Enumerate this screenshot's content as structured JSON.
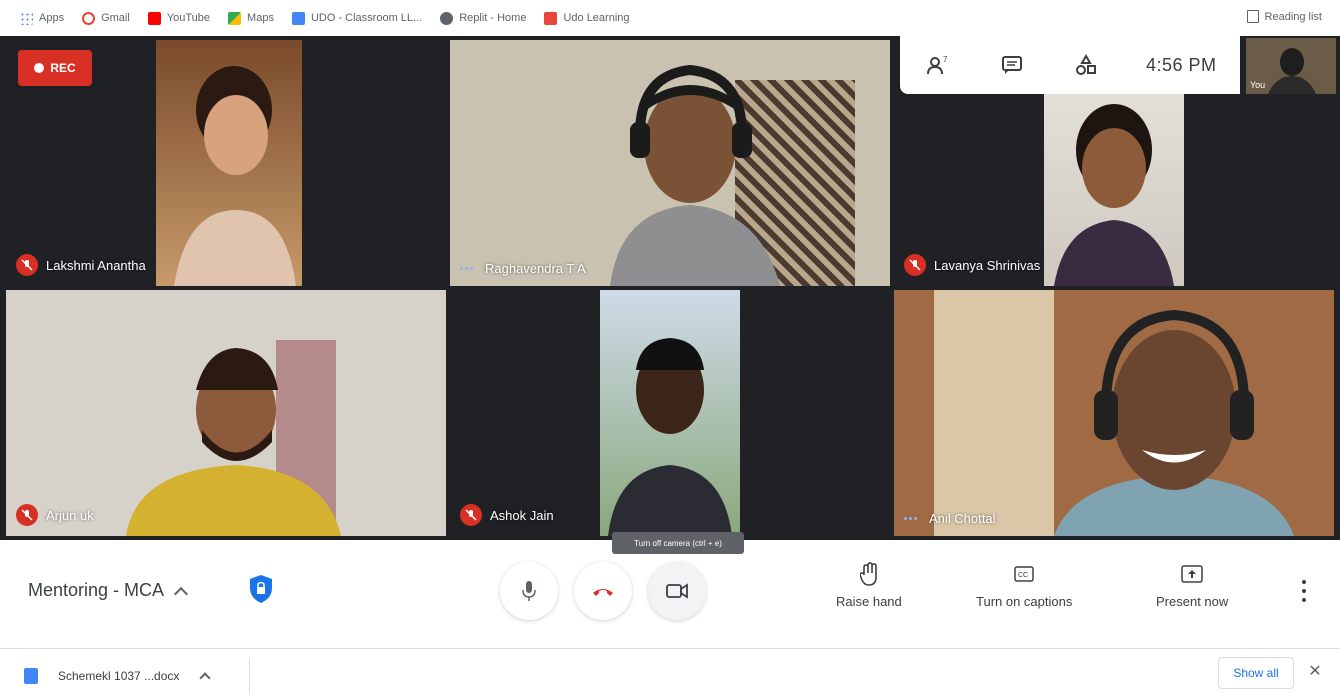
{
  "bookmarks": [
    {
      "label": "Apps",
      "color": "#4285f4"
    },
    {
      "label": "Gmail",
      "color": "#ea4335"
    },
    {
      "label": "YouTube",
      "color": "#ff0000"
    },
    {
      "label": "Maps",
      "color": "#34a853"
    },
    {
      "label": "UDO - Classroom LL...",
      "color": "#4285f4"
    },
    {
      "label": "Replit - Home",
      "color": "#5f6368"
    },
    {
      "label": "Udo Learning",
      "color": "#e8453c"
    }
  ],
  "reading_list": "Reading list",
  "recording": {
    "label": "REC"
  },
  "infobar": {
    "participants_count": "7",
    "time": "4:56 PM",
    "self_label": "You"
  },
  "participants": [
    {
      "name": "Lakshmi Anantha",
      "muted": true
    },
    {
      "name": "Raghavendra T A",
      "muted": false
    },
    {
      "name": "Lavanya Shrinivas",
      "muted": true
    },
    {
      "name": "Arjun uk",
      "muted": true
    },
    {
      "name": "Ashok Jain",
      "muted": true
    },
    {
      "name": "Anil Chottal",
      "muted": false
    }
  ],
  "meeting": {
    "title": "Mentoring - MCA"
  },
  "controls": {
    "tooltip": "Turn off camera (ctrl + e)",
    "raise_hand": "Raise hand",
    "captions": "Turn on captions",
    "present": "Present now"
  },
  "downloads": {
    "file": "Schemekl 1037 ...docx",
    "show_all": "Show all",
    "close": "✕"
  },
  "colors": {
    "accent_red": "#d93025",
    "stage_bg": "#202124",
    "link_blue": "#1a73e8"
  }
}
